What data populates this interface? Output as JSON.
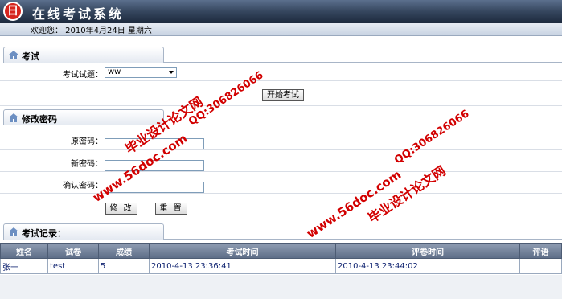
{
  "header": {
    "logo_char": "日",
    "title": "在线考试系统"
  },
  "welcome": "欢迎您： 2010年4月24日 星期六",
  "exam": {
    "section_title": "考试",
    "paper_label": "考试试题：",
    "paper_value": "ww",
    "start_button": "开始考试"
  },
  "password": {
    "section_title": "修改密码",
    "old_label": "原密码：",
    "new_label": "新密码：",
    "confirm_label": "确认密码：",
    "edit_button": "修 改",
    "reset_button": "重 置"
  },
  "records": {
    "section_title": "考试记录：",
    "columns": [
      "姓名",
      "试卷",
      "成绩",
      "考试时间",
      "评卷时间",
      "评语"
    ],
    "rows": [
      [
        "张一",
        "test",
        "5",
        "2010-4-13 23:36:41",
        "2010-4-13 23:44:02",
        ""
      ]
    ]
  },
  "watermark": {
    "line1": "毕业设计论文网",
    "line2": "www.56doc.com",
    "line3": "QQ:306826066"
  },
  "colors": {
    "header": "#36475f",
    "logo": "#d6251e",
    "watermark": "#d20000",
    "link_text": "#0b1f6e"
  }
}
